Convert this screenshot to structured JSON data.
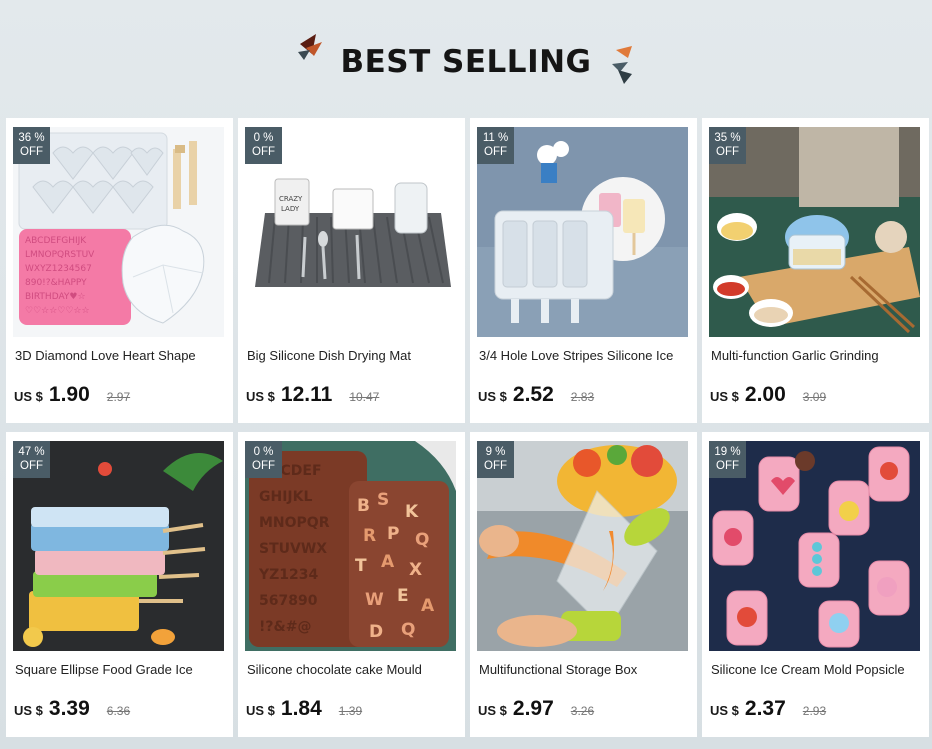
{
  "header": {
    "title": "BEST SELLING"
  },
  "colors": {
    "badge": "#4a5c66",
    "background": "#dfe5e8",
    "accent": "#c0562a"
  },
  "products": [
    {
      "discount": "36 %",
      "off": "OFF",
      "name": "3D Diamond Love Heart Shape",
      "currency": "US $",
      "price": "1.90",
      "old_price": "2.97",
      "image": "heart-mold-image"
    },
    {
      "discount": "0 %",
      "off": "OFF",
      "name": "Big Silicone Dish Drying Mat",
      "currency": "US $",
      "price": "12.11",
      "old_price": "10.47",
      "image": "drying-mat-image"
    },
    {
      "discount": "11 %",
      "off": "OFF",
      "name": "3/4 Hole Love Stripes Silicone Ice",
      "currency": "US $",
      "price": "2.52",
      "old_price": "2.83",
      "image": "ice-mold-image"
    },
    {
      "discount": "35 %",
      "off": "OFF",
      "name": "Multi-function Garlic Grinding",
      "currency": "US $",
      "price": "2.00",
      "old_price": "3.09",
      "image": "garlic-grinder-image"
    },
    {
      "discount": "47 %",
      "off": "OFF",
      "name": "Square Ellipse Food Grade Ice",
      "currency": "US $",
      "price": "3.39",
      "old_price": "6.36",
      "image": "popsicle-mold-image"
    },
    {
      "discount": "0 %",
      "off": "OFF",
      "name": "Silicone chocolate cake Mould",
      "currency": "US $",
      "price": "1.84",
      "old_price": "1.39",
      "image": "chocolate-mould-image"
    },
    {
      "discount": "9 %",
      "off": "OFF",
      "name": "Multifunctional Storage Box",
      "currency": "US $",
      "price": "2.97",
      "old_price": "3.26",
      "image": "peeler-image"
    },
    {
      "discount": "19 %",
      "off": "OFF",
      "name": "Silicone Ice Cream Mold Popsicle",
      "currency": "US $",
      "price": "2.37",
      "old_price": "2.93",
      "image": "ice-cream-mold-image"
    }
  ]
}
